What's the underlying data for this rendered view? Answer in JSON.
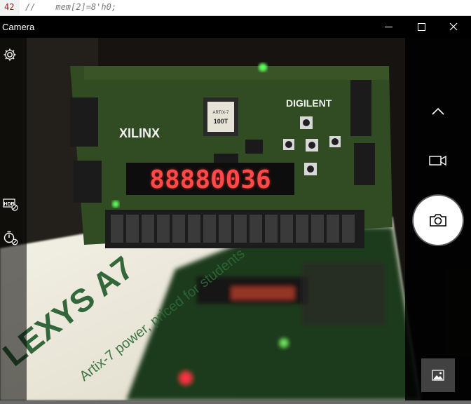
{
  "editor": {
    "line_number": "42",
    "line_text": "//    mem[2]=8'h0;"
  },
  "window": {
    "title": "Camera",
    "controls": [
      "minimize",
      "maximize",
      "close"
    ]
  },
  "camera": {
    "left_controls": [
      "settings-icon",
      "hdr-off-icon",
      "timer-off-icon"
    ],
    "right_controls": [
      "chevron-up-icon",
      "video-icon",
      "photo-shutter-button",
      "gallery-thumbnail"
    ],
    "scene": {
      "display_readout": "88880036",
      "board_brand": "XILINX",
      "board_vendor": "DIGILENT",
      "chip_label": "ARTIX-7",
      "chip_model": "100T",
      "banner_text_1": "LEXYS A7",
      "banner_text_2": "Artix-7 power, priced for students"
    }
  },
  "colors": {
    "titlebar": "#000000",
    "board_green": "#2f4a1e",
    "segment_red": "#ff2a2a",
    "led_green": "#5cff5c"
  }
}
